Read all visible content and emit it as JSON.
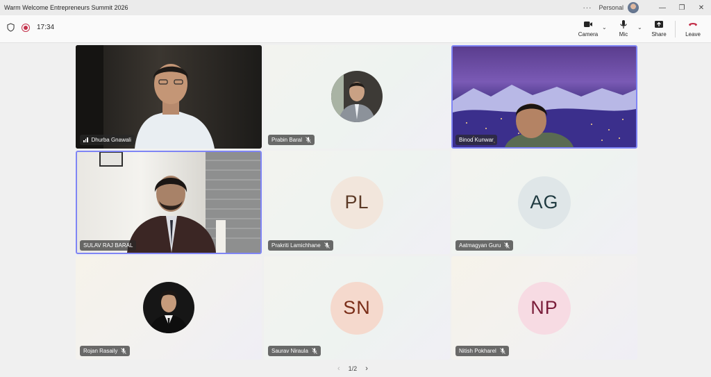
{
  "window": {
    "title": "Warm Welcome Entrepreneurs Summit 2026",
    "more": "···",
    "profile_label": "Personal"
  },
  "toolbar": {
    "timer": "17:34",
    "camera_label": "Camera",
    "mic_label": "Mic",
    "share_label": "Share",
    "leave_label": "Leave"
  },
  "participants": [
    {
      "name": "Dhurba Gnawali",
      "view": "video"
    },
    {
      "name": "Prabin Baral",
      "view": "photo",
      "muted": true
    },
    {
      "name": "Binod Kunwar",
      "view": "video",
      "active": true
    },
    {
      "name": "SULAV RAJ BARAL",
      "view": "video",
      "active": true
    },
    {
      "name": "Prakriti Lamichhane",
      "view": "initials",
      "initials": "PL",
      "muted": true,
      "avatar_bg": "#f2e6dc",
      "avatar_fg": "#5c3a26"
    },
    {
      "name": "Aatmagyan Guru",
      "view": "initials",
      "initials": "AG",
      "muted": true,
      "avatar_bg": "#dfe6e8",
      "avatar_fg": "#1f3a40"
    },
    {
      "name": "Rojan Rasaily",
      "view": "photo",
      "muted": true
    },
    {
      "name": "Saurav Niraula",
      "view": "initials",
      "initials": "SN",
      "muted": true,
      "avatar_bg": "#f5d9cd",
      "avatar_fg": "#7a2d18"
    },
    {
      "name": "Nitish Pokharel",
      "view": "initials",
      "initials": "NP",
      "muted": true,
      "avatar_bg": "#f7dbe3",
      "avatar_fg": "#7a1d3a"
    }
  ],
  "pagination": {
    "label": "1/2"
  },
  "colors": {
    "active_border": "#7f85f5",
    "leave": "#c4314b",
    "recording": "#c4314b"
  }
}
